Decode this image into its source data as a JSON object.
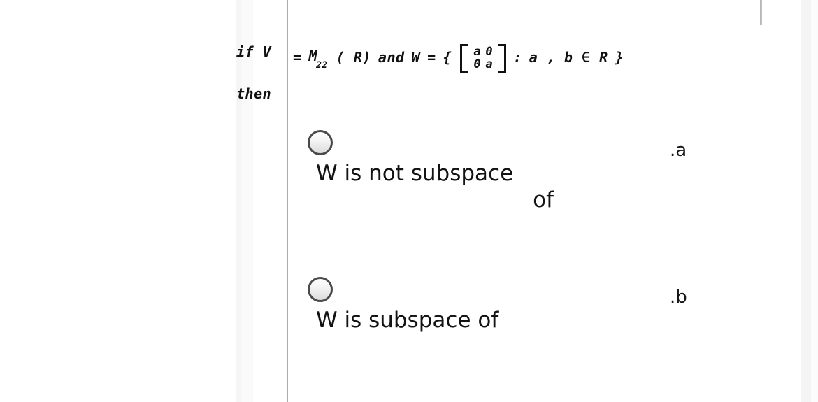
{
  "question": {
    "gutter": {
      "if_label": "if  V",
      "then_label": "then"
    },
    "stem": {
      "equals_1": "=",
      "space_v": "M",
      "space_v_sub": "22",
      "space_v_arg": "(  R)",
      "conjunction": "and",
      "w_symbol": "W",
      "equals_2": "=",
      "set_open": "{",
      "matrix": {
        "row1": [
          "a",
          "0"
        ],
        "row2": [
          "0",
          "a"
        ]
      },
      "colon": ":",
      "condition": "a  ,  b  ∈  R",
      "set_close": "}"
    }
  },
  "options": [
    {
      "key": ".a",
      "label_line1": "W is not subspace",
      "label_line2": "of",
      "selected": false
    },
    {
      "key": ".b",
      "label_line1": "W is subspace of",
      "label_line2": "",
      "selected": false
    }
  ],
  "colors": {
    "text": "#131313",
    "rule": "#8e8e8e",
    "radio_border": "#4a4a4a",
    "band": "#f4f4f4"
  }
}
